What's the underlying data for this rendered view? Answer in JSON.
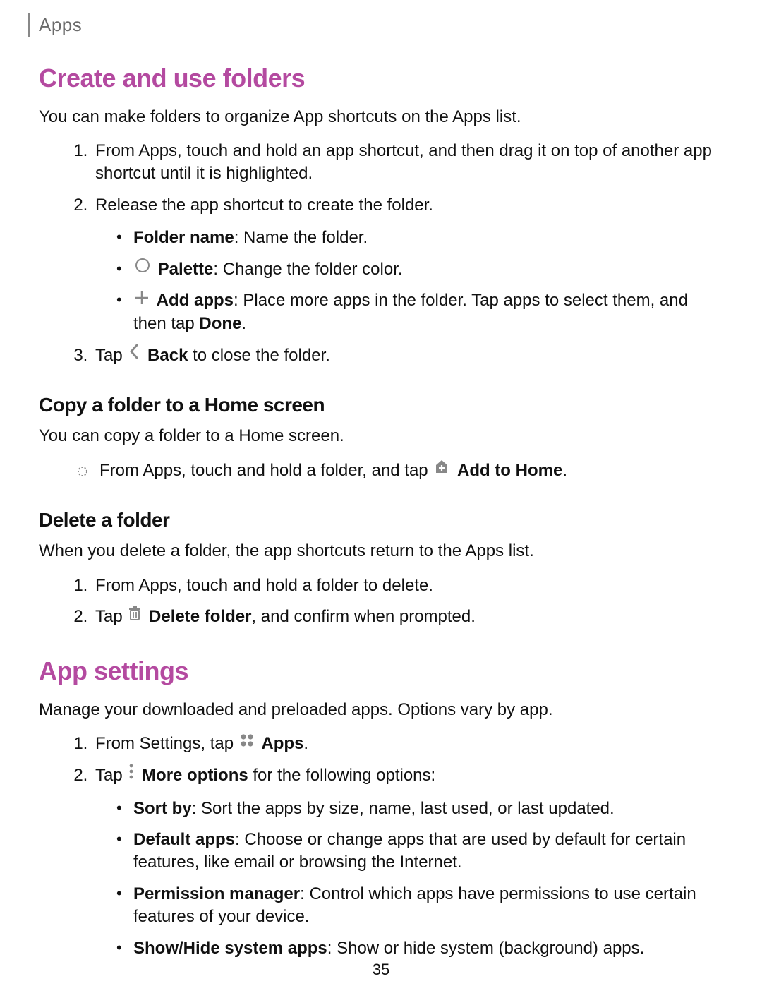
{
  "breadcrumb": "Apps",
  "pageNumber": "35",
  "section1": {
    "title": "Create and use folders",
    "intro": "You can make folders to organize App shortcuts on the Apps list.",
    "steps": {
      "s1": "From Apps, touch and hold an app shortcut, and then drag it on top of another app shortcut until it is highlighted.",
      "s2": "Release the app shortcut to create the folder.",
      "s3_pre": "Tap ",
      "s3_label": "Back",
      "s3_post": " to close the folder."
    },
    "sub": {
      "folderName_label": "Folder name",
      "folderName_desc": ": Name the folder.",
      "palette_label": "Palette",
      "palette_desc": ": Change the folder color.",
      "addApps_label": "Add apps",
      "addApps_desc_pre": ": Place more apps in the folder. Tap apps to select them, and then tap ",
      "addApps_done": "Done",
      "addApps_desc_post": "."
    },
    "copy": {
      "title": "Copy a folder to a Home screen",
      "intro": "You can copy a folder to a Home screen.",
      "line_pre": "From Apps, touch and hold a folder, and tap ",
      "line_label": "Add to Home",
      "line_post": "."
    },
    "delete": {
      "title": "Delete a folder",
      "intro": "When you delete a folder, the app shortcuts return to the Apps list.",
      "s1": "From Apps, touch and hold a folder to delete.",
      "s2_pre": "Tap ",
      "s2_label": "Delete folder",
      "s2_post": ", and confirm when prompted."
    }
  },
  "section2": {
    "title": "App settings",
    "intro": "Manage your downloaded and preloaded apps. Options vary by app.",
    "s1_pre": "From Settings, tap ",
    "s1_label": "Apps",
    "s1_post": ".",
    "s2_pre": "Tap ",
    "s2_label": "More options",
    "s2_post": " for the following options:",
    "opts": {
      "sort_label": "Sort by",
      "sort_desc": ": Sort the apps by size, name, last used, or last updated.",
      "default_label": "Default apps",
      "default_desc": ": Choose or change apps that are used by default for certain features, like email or browsing the Internet.",
      "perm_label": "Permission manager",
      "perm_desc": ": Control which apps have permissions to use certain features of your device.",
      "show_label": "Show/Hide system apps",
      "show_desc": ": Show or hide system (background) apps."
    }
  }
}
